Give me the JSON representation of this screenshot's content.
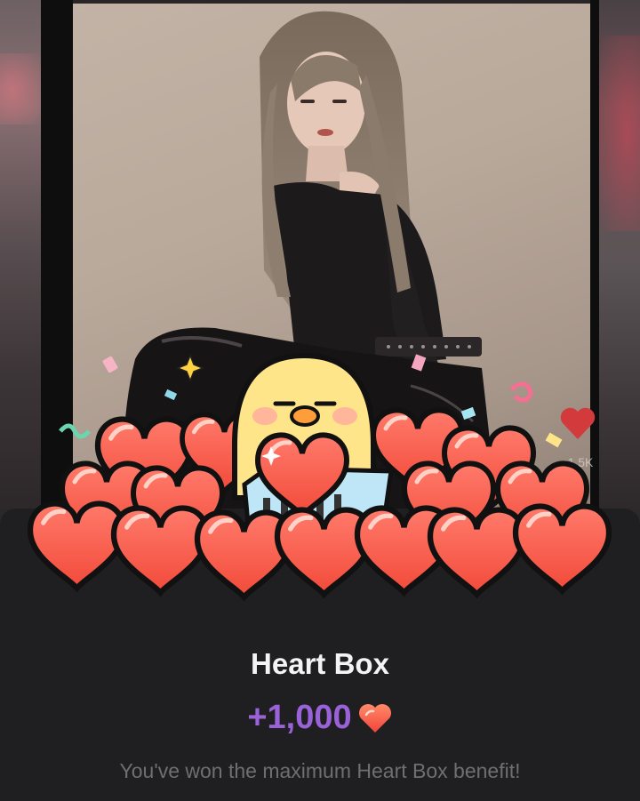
{
  "like": {
    "count": "1.5K",
    "icon": "heart-icon"
  },
  "reward": {
    "title": "Heart Box",
    "amount": "+1,000",
    "amount_icon": "heart-icon",
    "message": "You've won the maximum Heart Box benefit!"
  },
  "colors": {
    "accent_purple": "#9a62d8",
    "heart_red": "#f25a46",
    "sheet_bg": "#1f1f21"
  }
}
